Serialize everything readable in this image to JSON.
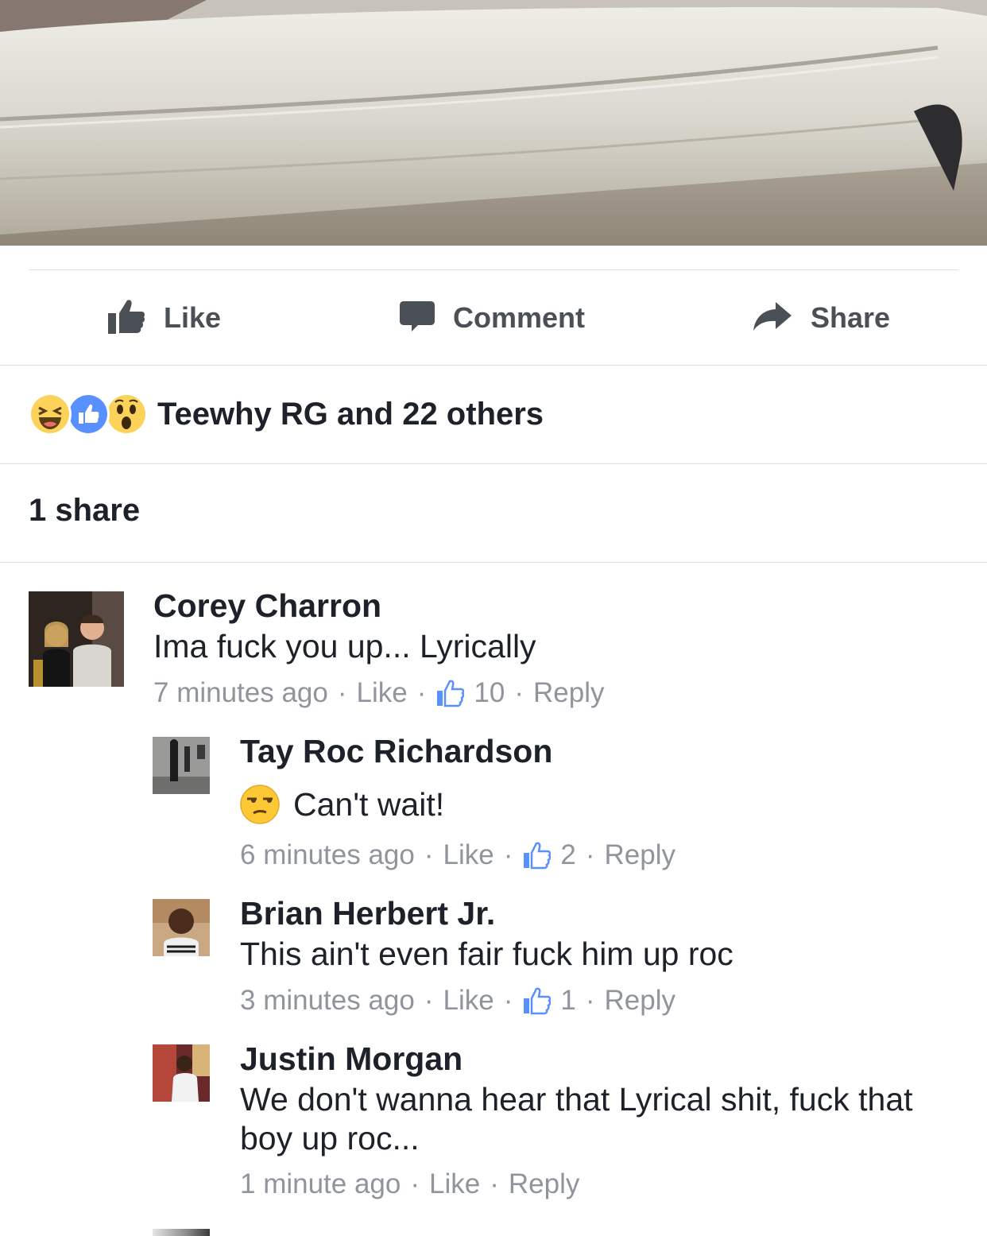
{
  "actions": {
    "like_label": "Like",
    "comment_label": "Comment",
    "share_label": "Share"
  },
  "reactions": {
    "icons": [
      "haha-reaction-icon",
      "like-reaction-icon",
      "wow-reaction-icon"
    ],
    "summary": "Teewhy RG and 22 others"
  },
  "shares": {
    "text": "1 share"
  },
  "comments": [
    {
      "name": "Corey Charron",
      "text": "Ima fuck you up... Lyrically",
      "time": "7 minutes ago",
      "like": "Like",
      "likes": "10",
      "reply": "Reply"
    },
    {
      "name": "Tay Roc Richardson",
      "text": "Can't wait!",
      "emoji": "unamused-face-icon",
      "time": "6 minutes ago",
      "like": "Like",
      "likes": "2",
      "reply": "Reply"
    },
    {
      "name": "Brian Herbert Jr.",
      "text": "This ain't even fair fuck him up roc",
      "time": "3 minutes ago",
      "like": "Like",
      "likes": "1",
      "reply": "Reply"
    },
    {
      "name": "Justin Morgan",
      "text": "We don't wanna hear that Lyrical shit, fuck that boy up roc...",
      "time": "1 minute ago",
      "like": "Like",
      "reply": "Reply"
    }
  ],
  "colors": {
    "text_primary": "#1d2129",
    "text_secondary": "#90949c",
    "action_text": "#4b4f56",
    "like_blue": "#5890ff",
    "divider": "#dddfe2"
  }
}
